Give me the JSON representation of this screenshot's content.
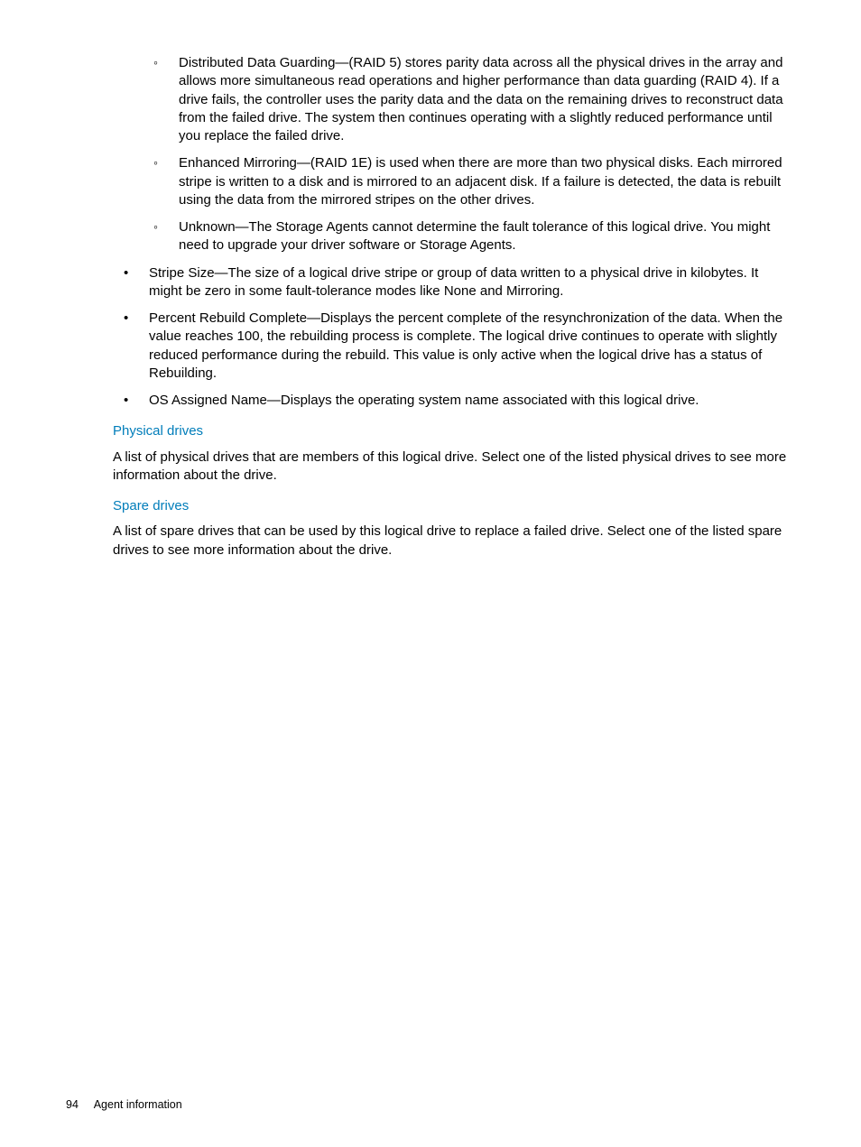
{
  "sublist": {
    "item1": "Distributed Data Guarding—(RAID 5) stores parity data across all the physical drives in the array and allows more simultaneous read operations and higher performance than data guarding (RAID 4). If a drive fails, the controller uses the parity data and the data on the remaining drives to reconstruct data from the failed drive. The system then continues operating with a slightly reduced performance until you replace the failed drive.",
    "item2": "Enhanced Mirroring—(RAID 1E) is used when there are more than two physical disks. Each mirrored stripe is written to a disk and is mirrored to an adjacent disk. If a failure is detected, the data is rebuilt using the data from the mirrored stripes on the other drives.",
    "item3": "Unknown—The Storage Agents cannot determine the fault tolerance of this logical drive. You might need to upgrade your driver software or Storage Agents."
  },
  "mainlist": {
    "item1": "Stripe Size—The size of a logical drive stripe or group of data written to a physical drive in kilobytes. It might be zero in some fault-tolerance modes like None and Mirroring.",
    "item2": "Percent Rebuild Complete—Displays the percent complete of the resynchronization of the data. When the value reaches 100, the rebuilding process is complete. The logical drive continues to operate with slightly reduced performance during the rebuild. This value is only active when the logical drive has a status of Rebuilding.",
    "item3": "OS Assigned Name—Displays the operating system name associated with this logical drive."
  },
  "sections": {
    "physical": {
      "heading": "Physical drives",
      "text": "A list of physical drives that are members of this logical drive. Select one of the listed physical drives to see more information about the drive."
    },
    "spare": {
      "heading": "Spare drives",
      "text": "A list of spare drives that can be used by this logical drive to replace a failed drive. Select one of the listed spare drives to see more information about the drive."
    }
  },
  "footer": {
    "pageNumber": "94",
    "sectionTitle": "Agent information"
  }
}
